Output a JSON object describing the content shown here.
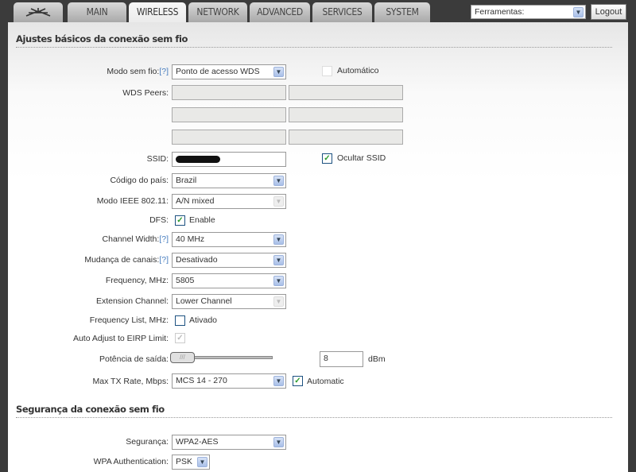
{
  "nav": {
    "tabs": [
      "MAIN",
      "WIRELESS",
      "NETWORK",
      "ADVANCED",
      "SERVICES",
      "SYSTEM"
    ],
    "active": "WIRELESS",
    "tools_label": "Ferramentas:",
    "logout": "Logout"
  },
  "basic": {
    "title": "Ajustes básicos da conexão sem fio",
    "mode_label": "Modo sem fio:",
    "help": "[?]",
    "mode_value": "Ponto de acesso WDS",
    "auto_label": "Automático",
    "wds_label": "WDS Peers:",
    "ssid_label": "SSID:",
    "hide_ssid": "Ocultar SSID",
    "country_label": "Código do país:",
    "country_value": "Brazil",
    "ieee_label": "Modo IEEE 802.11:",
    "ieee_value": "A/N mixed",
    "dfs_label": "DFS:",
    "dfs_value": "Enable",
    "width_label": "Channel Width:",
    "width_value": "40 MHz",
    "shift_label": "Mudança de canais:",
    "shift_value": "Desativado",
    "freq_label": "Frequency, MHz:",
    "freq_value": "5805",
    "ext_label": "Extension Channel:",
    "ext_value": "Lower Channel",
    "flist_label": "Frequency List, MHz:",
    "flist_value": "Ativado",
    "eirp_label": "Auto Adjust to EIRP Limit:",
    "power_label": "Potência de saída:",
    "power_value": "8",
    "power_unit": "dBm",
    "rate_label": "Max TX Rate, Mbps:",
    "rate_value": "MCS 14 - 270",
    "rate_auto": "Automatic"
  },
  "security": {
    "title": "Segurança da conexão sem fio",
    "sec_label": "Segurança:",
    "sec_value": "WPA2-AES",
    "auth_label": "WPA Authentication:",
    "auth_value": "PSK"
  }
}
